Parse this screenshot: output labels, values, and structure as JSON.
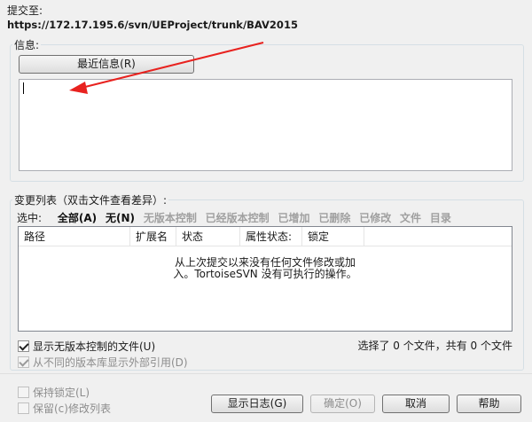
{
  "commit_to": {
    "label": "提交至:",
    "url": "https://172.17.195.6/svn/UEProject/trunk/BAV2015"
  },
  "message": {
    "group_title": "信息:",
    "recent_button": "最近信息(R)",
    "value": ""
  },
  "changes": {
    "group_title": "变更列表（双击文件查看差异）:",
    "select_label": "选中:",
    "filters": [
      {
        "label": "全部(A)",
        "enabled": true
      },
      {
        "label": "无(N)",
        "enabled": true
      },
      {
        "label": "无版本控制",
        "enabled": false
      },
      {
        "label": "已经版本控制",
        "enabled": false
      },
      {
        "label": "已增加",
        "enabled": false
      },
      {
        "label": "已删除",
        "enabled": false
      },
      {
        "label": "已修改",
        "enabled": false
      },
      {
        "label": "文件",
        "enabled": false
      },
      {
        "label": "目录",
        "enabled": false
      }
    ],
    "columns": [
      "路径",
      "扩展名",
      "状态",
      "属性状态:",
      "锁定"
    ],
    "empty_line1": "从上次提交以来没有任何文件修改或加",
    "empty_line2": "入。TortoiseSVN 没有可执行的操作。",
    "show_unversioned": {
      "label": "显示无版本控制的文件(U)",
      "checked": true
    },
    "show_externals": {
      "label": "从不同的版本库显示外部引用(D)",
      "checked": true
    },
    "selected_count": "选择了 0 个文件，共有 0 个文件"
  },
  "footer": {
    "keep_locks": {
      "label": "保持锁定(L)",
      "checked": false
    },
    "keep_changelists": {
      "label": "保留(c)修改列表",
      "checked": false
    },
    "show_log_button": "显示日志(G)",
    "ok_button": "确定(O)",
    "cancel_button": "取消",
    "help_button": "帮助"
  },
  "annotation_color": "#e8221f"
}
